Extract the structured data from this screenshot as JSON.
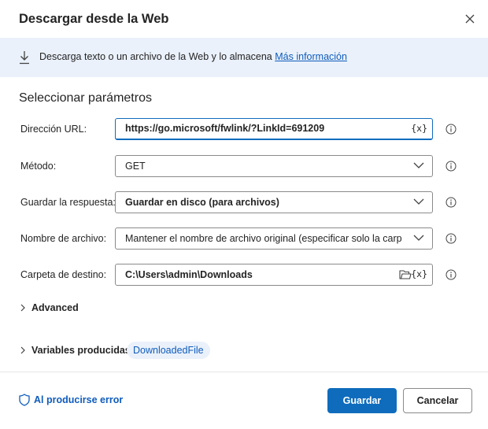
{
  "dialog": {
    "title": "Descargar desde la Web",
    "close_icon": "close-icon"
  },
  "banner": {
    "icon": "download-icon",
    "text": "Descarga texto o un archivo de la Web y lo almacena",
    "link": "Más información"
  },
  "section_title": "Seleccionar parámetros",
  "fields": {
    "url": {
      "label": "Dirección URL:",
      "value": "https://go.microsoft/fwlink/?LinkId=691209",
      "var_button": "{x}"
    },
    "method": {
      "label": "Método:",
      "value": "GET"
    },
    "save_response": {
      "label": "Guardar la respuesta:",
      "value": "Guardar en disco (para archivos)"
    },
    "file_name": {
      "label": "Nombre de archivo:",
      "value": "Mantener el nombre de archivo original (especificar solo la carpeta"
    },
    "destination_folder": {
      "label": "Carpeta de destino:",
      "value": "C:\\Users\\admin\\Downloads",
      "var_button": "{x}"
    }
  },
  "advanced": {
    "label": "Advanced"
  },
  "variables": {
    "label": "Variables producidas",
    "chip": "DownloadedFile"
  },
  "footer": {
    "error_link": "Al producirse error",
    "save_label": "Guardar",
    "cancel_label": "Cancelar"
  },
  "colors": {
    "accent": "#0f6cbd",
    "link": "#0f5cbd",
    "banner_bg": "#eaf1fb"
  }
}
